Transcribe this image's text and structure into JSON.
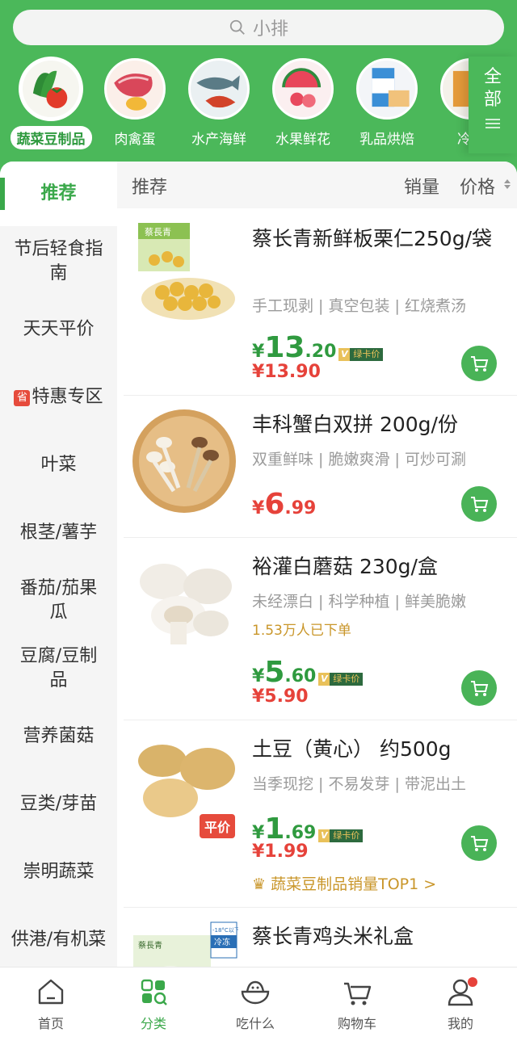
{
  "search": {
    "placeholder": "小排",
    "icon": "search-icon"
  },
  "categories": [
    {
      "label": "蔬菜豆制品",
      "active": true
    },
    {
      "label": "肉禽蛋",
      "active": false
    },
    {
      "label": "水产海鲜",
      "active": false
    },
    {
      "label": "水果鲜花",
      "active": false
    },
    {
      "label": "乳品烘焙",
      "active": false
    },
    {
      "label": "冷冻",
      "active": false
    }
  ],
  "all_button": {
    "line1": "全",
    "line2": "部"
  },
  "sidebar": {
    "items": [
      {
        "label": "推荐",
        "active": true
      },
      {
        "label": "节后轻食指南"
      },
      {
        "label": "天天平价"
      },
      {
        "label": "特惠专区",
        "badge": "省"
      },
      {
        "label": "叶菜"
      },
      {
        "label": "根茎/薯芋"
      },
      {
        "label": "番茄/茄果瓜"
      },
      {
        "label": "豆腐/豆制品"
      },
      {
        "label": "营养菌菇"
      },
      {
        "label": "豆类/芽苗"
      },
      {
        "label": "崇明蔬菜"
      },
      {
        "label": "供港/有机菜"
      }
    ]
  },
  "sortbar": {
    "recommend": "推荐",
    "sales": "销量",
    "price": "价格"
  },
  "products": [
    {
      "title": "蔡长青新鲜板栗仁250g/袋",
      "tags": "手工现剥 | 真空包装 | 红烧煮汤",
      "price_currency": "¥",
      "price_int": "13",
      "price_dec": ".20",
      "vip_label": "绿卡价",
      "orig_price": "¥13.90",
      "image_text": "蔡長青"
    },
    {
      "title": "丰科蟹白双拼 200g/份",
      "tags": "双重鲜味 | 脆嫩爽滑 | 可炒可涮",
      "price_currency": "¥",
      "price_int": "6",
      "price_dec": ".99"
    },
    {
      "title": "裕灌白蘑菇 230g/盒",
      "tags": "未经漂白 | 科学种植 | 鲜美脆嫩",
      "sold": "1.53万人已下单",
      "price_currency": "¥",
      "price_int": "5",
      "price_dec": ".60",
      "vip_label": "绿卡价",
      "orig_price": "¥5.90"
    },
    {
      "title": "土豆（黄心） 约500g",
      "tags": "当季现挖 | 不易发芽 | 带泥出土",
      "price_currency": "¥",
      "price_int": "1",
      "price_dec": ".69",
      "vip_label": "绿卡价",
      "orig_price": "¥1.99",
      "badge": "平价",
      "rank": "蔬菜豆制品销量TOP1 >"
    },
    {
      "title": "蔡长青鸡头米礼盒",
      "image_text_left": "蔡長青",
      "image_text_right": "冷冻",
      "image_text_temp": "-18°C以下"
    }
  ],
  "tabbar": [
    {
      "label": "首页",
      "icon": "home-icon"
    },
    {
      "label": "分类",
      "icon": "category-icon",
      "active": true
    },
    {
      "label": "吃什么",
      "icon": "bowl-icon"
    },
    {
      "label": "购物车",
      "icon": "cart-icon"
    },
    {
      "label": "我的",
      "icon": "user-icon"
    }
  ],
  "colors": {
    "brand_green": "#4bb85a",
    "price_green": "#2f9a3f",
    "price_red": "#e6423a"
  }
}
